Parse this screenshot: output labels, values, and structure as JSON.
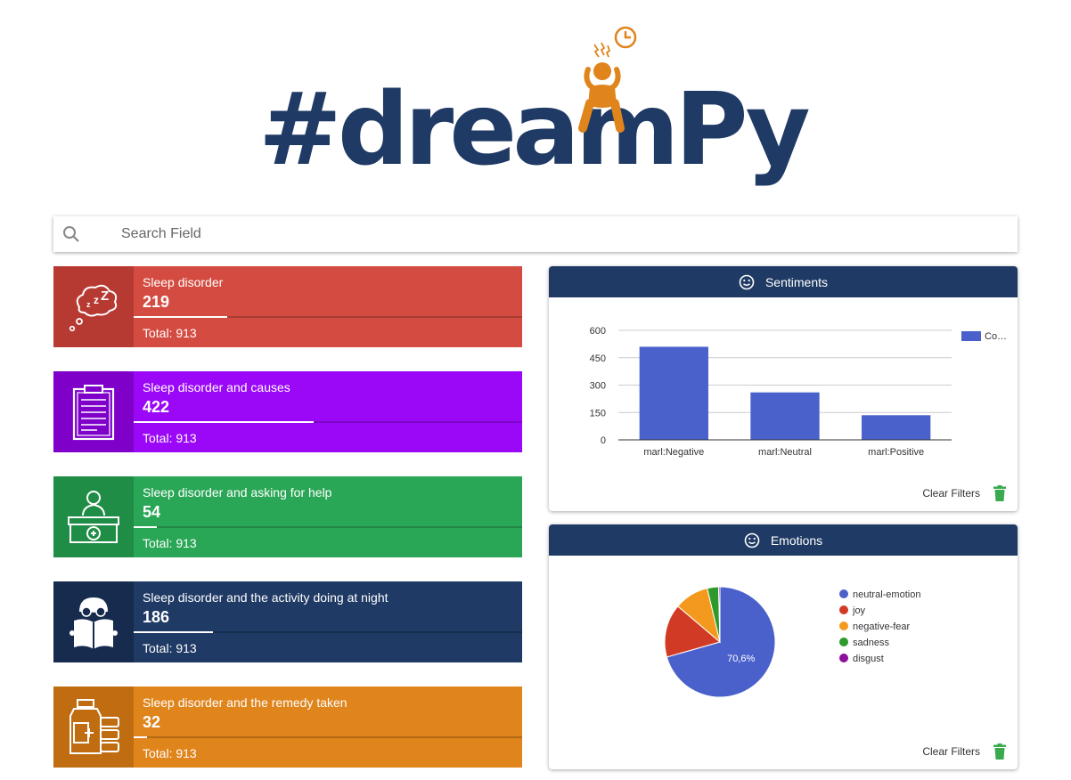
{
  "logo": {
    "text": "#dreamPy"
  },
  "search": {
    "placeholder": "Search Field"
  },
  "cards": [
    {
      "label": "Sleep disorder",
      "value": "219",
      "total": "Total: 913",
      "fraction": 0.2399,
      "color": "#d44c41",
      "icon_color": "#b73a32",
      "icon": "sleep-icon"
    },
    {
      "label": "Sleep disorder and causes",
      "value": "422",
      "total": "Total: 913",
      "fraction": 0.4622,
      "color": "#9b08f7",
      "icon_color": "#7e00c9",
      "icon": "clipboard-icon"
    },
    {
      "label": "Sleep disorder and asking for help",
      "value": "54",
      "total": "Total: 913",
      "fraction": 0.0591,
      "color": "#2aa756",
      "icon_color": "#1f8d46",
      "icon": "doctor-icon"
    },
    {
      "label": "Sleep disorder and the activity doing at night",
      "value": "186",
      "total": "Total: 913",
      "fraction": 0.2037,
      "color": "#1f3a64",
      "icon_color": "#162b4d",
      "icon": "reading-icon"
    },
    {
      "label": "Sleep disorder and the remedy taken",
      "value": "32",
      "total": "Total: 913",
      "fraction": 0.035,
      "color": "#e0841c",
      "icon_color": "#c06d12",
      "icon": "pills-icon"
    }
  ],
  "sentiments": {
    "title": "Sentiments",
    "clear_label": "Clear Filters",
    "chart_data": {
      "type": "bar",
      "categories": [
        "marl:Negative",
        "marl:Neutral",
        "marl:Positive"
      ],
      "series": [
        {
          "name": "Co…",
          "values": [
            510,
            260,
            135
          ]
        }
      ],
      "yticks": [
        0,
        150,
        300,
        450,
        600
      ],
      "ylim": [
        0,
        600
      ],
      "grid": true,
      "legend": "top-right",
      "color": "#4a61cc"
    }
  },
  "emotions": {
    "title": "Emotions",
    "clear_label": "Clear Filters",
    "chart_data": {
      "type": "pie",
      "labels": [
        "neutral-emotion",
        "joy",
        "negative-fear",
        "sadness",
        "disgust"
      ],
      "values": [
        70.6,
        15.6,
        10.1,
        3.3,
        0.4
      ],
      "colors": [
        "#4a61cc",
        "#d13b26",
        "#f39a1e",
        "#2e9a2b",
        "#8d0f9a"
      ],
      "slice_label": "70,6%",
      "legend": "right"
    }
  }
}
